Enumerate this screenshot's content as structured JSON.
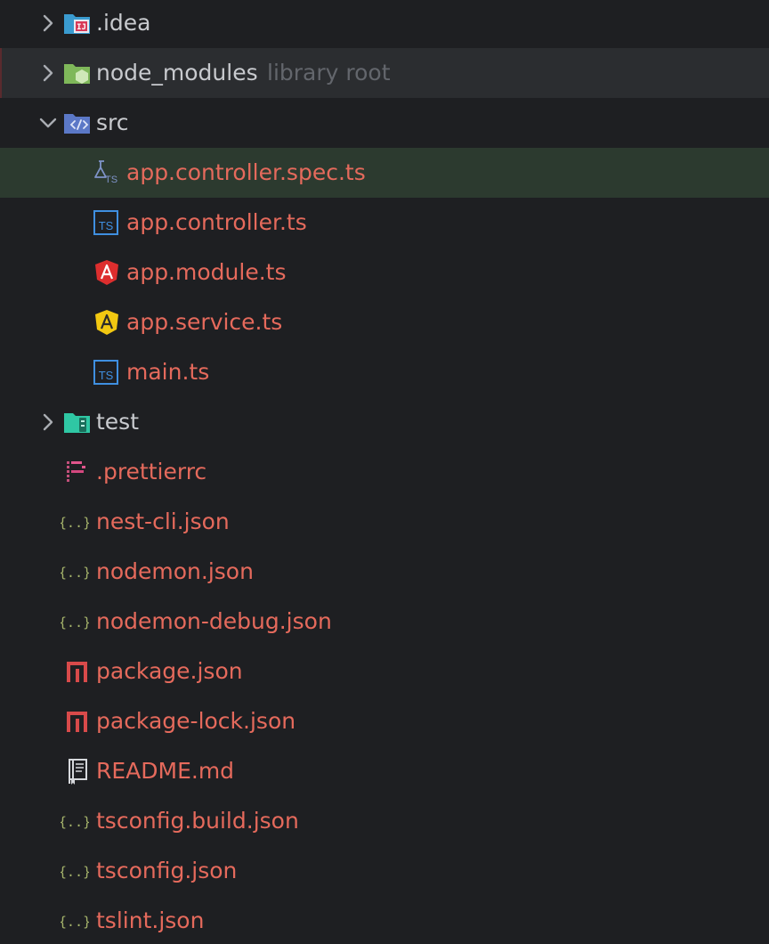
{
  "colors": {
    "background": "#1e1f22",
    "file_text": "#e56a5c",
    "folder_text": "#c8cace",
    "hint_text": "#63666c",
    "selected_row": "#2c3a2f",
    "library_row": "#2b2d30",
    "json_icon": "#a5b36b",
    "ts_icon": "#3f8fe0",
    "angular_red": "#dd2e2e",
    "angular_yellow": "#f2c811",
    "npm_icon": "#d84a4a"
  },
  "tree": {
    "idea": {
      "label": ".idea",
      "icon": "idea-folder-icon",
      "expanded": false
    },
    "node_modules": {
      "label": "node_modules",
      "hint": "library root",
      "icon": "library-folder-icon",
      "expanded": false
    },
    "src": {
      "label": "src",
      "icon": "source-folder-icon",
      "expanded": true,
      "children": [
        {
          "label": "app.controller.spec.ts",
          "icon": "test-typescript-icon",
          "selected": true
        },
        {
          "label": "app.controller.ts",
          "icon": "typescript-icon"
        },
        {
          "label": "app.module.ts",
          "icon": "angular-module-icon"
        },
        {
          "label": "app.service.ts",
          "icon": "angular-service-icon"
        },
        {
          "label": "main.ts",
          "icon": "typescript-icon"
        }
      ]
    },
    "test": {
      "label": "test",
      "icon": "test-folder-icon",
      "expanded": false
    },
    "files": [
      {
        "label": ".prettierrc",
        "icon": "prettier-icon"
      },
      {
        "label": "nest-cli.json",
        "icon": "json-icon"
      },
      {
        "label": "nodemon.json",
        "icon": "json-icon"
      },
      {
        "label": "nodemon-debug.json",
        "icon": "json-icon"
      },
      {
        "label": "package.json",
        "icon": "npm-icon"
      },
      {
        "label": "package-lock.json",
        "icon": "npm-icon"
      },
      {
        "label": "README.md",
        "icon": "markdown-book-icon"
      },
      {
        "label": "tsconfig.build.json",
        "icon": "json-icon"
      },
      {
        "label": "tsconfig.json",
        "icon": "json-icon"
      },
      {
        "label": "tslint.json",
        "icon": "json-icon"
      }
    ]
  }
}
